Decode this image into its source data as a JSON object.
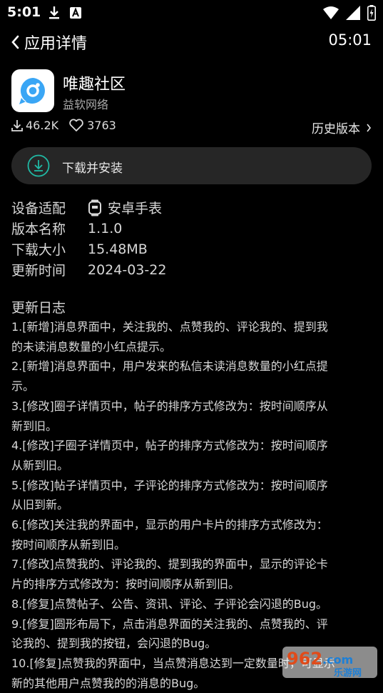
{
  "status_bar": {
    "time": "5:01",
    "left_icons": [
      "download-icon",
      "a-notification-icon"
    ],
    "right_icons": [
      "wifi-icon",
      "signal-icon",
      "battery-icon"
    ]
  },
  "header": {
    "title": "应用详情",
    "clock": "05:01"
  },
  "app": {
    "name": "唯趣社区",
    "developer": "益软网络",
    "downloads": "46.2K",
    "likes": "3763",
    "history_label": "历史版本",
    "icon_color": "#3aa6f5"
  },
  "install": {
    "label": "下载并安装",
    "accent": "#20b9a4"
  },
  "info": {
    "device_label": "设备适配",
    "device_value": "安卓手表",
    "version_label": "版本名称",
    "version_value": "1.1.0",
    "size_label": "下载大小",
    "size_value": "15.48MB",
    "date_label": "更新时间",
    "date_value": "2024-03-22"
  },
  "changelog": {
    "title": "更新日志",
    "text": "1.[新增]消息界面中，关注我的、点赞我的、评论我的、提到我\n的未读消息数量的小红点提示。\n2.[新增]消息界面中，用户发来的私信未读消息数量的小红点提\n示。\n3.[修改]圈子详情页中，帖子的排序方式修改为：按时间顺序从\n新到旧。\n4.[修改]子圈子详情页中，帖子的排序方式修改为：按时间顺序\n从新到旧。\n5.[修改]帖子详情页中，子评论的排序方式修改为：按时间顺序\n从旧到新。\n6.[修改]关注我的界面中，显示的用户卡片的排序方式修改为：\n按时间顺序从新到旧。\n7.[修改]点赞我的、评论我的、提到我的界面中，显示的评论卡\n片的排序方式修改为：按时间顺序从新到旧。\n8.[修复]点赞帖子、公告、资讯、评论、子评论会闪退的Bug。\n9.[修复]圆形布局下，点击消息界面的关注我的、点赞我的、评\n论我的、提到我的按钮，会闪退的Bug。\n10.[修复]点赞我的界面中，当点赞消息达到一定数量时，可显示\n新的其他用户点赞我的的消息的Bug。"
  },
  "watermark": {
    "brand": "962",
    "domain": ".com",
    "subtitle": "乐游网"
  }
}
